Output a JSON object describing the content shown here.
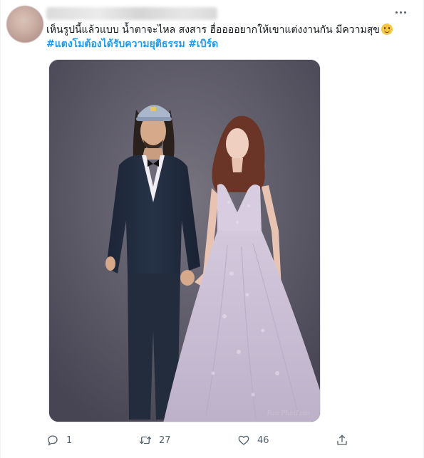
{
  "tweet": {
    "text_line1": "เห็นรูปนี้แล้วแบบ น้ำตาจะไหล สงสาร ฮื่ออออยากให้เขาแต่งงานกัน มีความสุข",
    "hashtag1": "#แตงโมต้องได้รับความยุติธรรม",
    "hashtag2": "#เบิร์ด",
    "emoji": "smiling-face-with-tear",
    "image_watermark": "Fan PhatLom"
  },
  "actions": {
    "reply_count": "1",
    "retweet_count": "27",
    "like_count": "46"
  },
  "colors": {
    "hashtag": "#1d9bf0",
    "icon": "#536471",
    "photo_background": "#5b5867"
  }
}
